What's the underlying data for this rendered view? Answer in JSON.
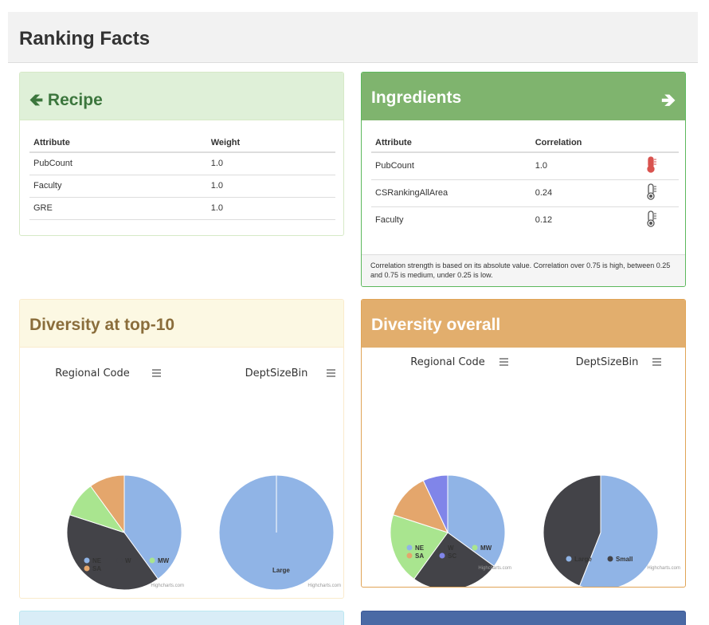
{
  "page": {
    "title": "Ranking Facts"
  },
  "recipe": {
    "title": "Recipe",
    "columns": [
      "Attribute",
      "Weight"
    ],
    "rows": [
      [
        "PubCount",
        "1.0"
      ],
      [
        "Faculty",
        "1.0"
      ],
      [
        "GRE",
        "1.0"
      ]
    ]
  },
  "ingredients": {
    "title": "Ingredients",
    "columns": [
      "Attribute",
      "Correlation"
    ],
    "rows": [
      {
        "attribute": "PubCount",
        "correlation": "1.0",
        "level": "high",
        "icon": "thermometer-high-icon"
      },
      {
        "attribute": "CSRankingAllArea",
        "correlation": "0.24",
        "level": "low",
        "icon": "thermometer-low-icon"
      },
      {
        "attribute": "Faculty",
        "correlation": "0.12",
        "level": "low",
        "icon": "thermometer-low-icon"
      }
    ],
    "footnote": "Correlation strength is based on its absolute value. Correlation over 0.75 is high, between 0.25 and 0.75 is medium, under 0.25 is low."
  },
  "diversity_top10": {
    "title": "Diversity at top-10"
  },
  "diversity_overall": {
    "title": "Diversity overall"
  },
  "colors": {
    "NE": "#90b4e6",
    "W": "#434348",
    "MW": "#a9e58f",
    "SA": "#e4a66c",
    "SC": "#8085e9",
    "Large": "#90b4e6",
    "Small": "#434348",
    "thermo_high": "#d9534f",
    "thermo_low": "#555555"
  },
  "chart_data": [
    {
      "type": "pie",
      "panel": "Diversity at top-10",
      "title": "Regional Code",
      "categories": [
        "NE",
        "W",
        "MW",
        "SA"
      ],
      "values": [
        4,
        4,
        1,
        1
      ],
      "legend": [
        "NE",
        "W",
        "MW",
        "SA"
      ],
      "credit": "Highcharts.com"
    },
    {
      "type": "pie",
      "panel": "Diversity at top-10",
      "title": "DeptSizeBin",
      "categories": [
        "Large"
      ],
      "values": [
        10
      ],
      "legend": [
        "Large"
      ],
      "credit": "Highcharts.com"
    },
    {
      "type": "pie",
      "panel": "Diversity overall",
      "title": "Regional Code",
      "categories": [
        "NE",
        "W",
        "MW",
        "SA",
        "SC"
      ],
      "values": [
        35,
        25,
        20,
        13,
        7
      ],
      "legend": [
        "NE",
        "W",
        "MW",
        "SA",
        "SC"
      ],
      "credit": "Highcharts.com"
    },
    {
      "type": "pie",
      "panel": "Diversity overall",
      "title": "DeptSizeBin",
      "categories": [
        "Large",
        "Small"
      ],
      "values": [
        56,
        44
      ],
      "legend": [
        "Large",
        "Small"
      ],
      "credit": "Highcharts.com"
    }
  ]
}
